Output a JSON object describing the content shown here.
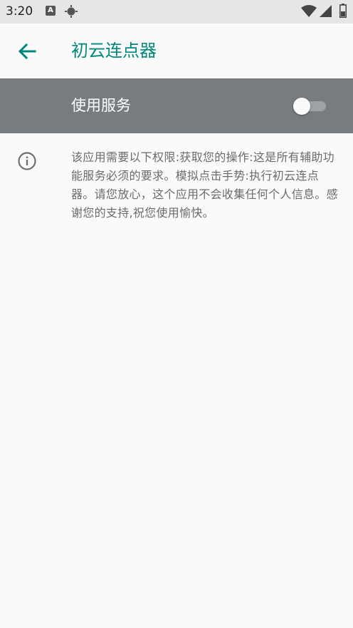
{
  "status_bar": {
    "time": "3:20",
    "a_icon_label": "A"
  },
  "app_bar": {
    "title": "初云连点器",
    "accent_color": "#00897b"
  },
  "service": {
    "label": "使用服务",
    "enabled": false,
    "row_color": "#767c80"
  },
  "description": {
    "text": "该应用需要以下权限:获取您的操作:这是所有辅助功能服务必须的要求。模拟点击手势:执行初云连点器。请您放心，这个应用不会收集任何个人信息。感谢您的支持,祝您使用愉快。"
  },
  "icons": {
    "back": "arrow-left-icon",
    "info": "info-icon",
    "wifi": "wifi-icon",
    "signal": "cell-signal-icon",
    "battery": "battery-icon",
    "location": "gps-target-icon"
  }
}
